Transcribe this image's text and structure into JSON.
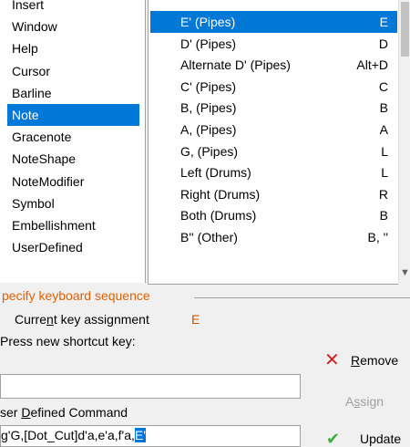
{
  "categories": [
    {
      "label": "Insert",
      "selected": false
    },
    {
      "label": "Window",
      "selected": false
    },
    {
      "label": "Help",
      "selected": false
    },
    {
      "label": "Cursor",
      "selected": false
    },
    {
      "label": "Barline",
      "selected": false
    },
    {
      "label": "Note",
      "selected": true
    },
    {
      "label": "Gracenote",
      "selected": false
    },
    {
      "label": "NoteShape",
      "selected": false
    },
    {
      "label": "NoteModifier",
      "selected": false
    },
    {
      "label": "Symbol",
      "selected": false
    },
    {
      "label": "Embellishment",
      "selected": false
    },
    {
      "label": "UserDefined",
      "selected": false
    }
  ],
  "commands": [
    {
      "name": "E' (Pipes)",
      "key": "E",
      "selected": true
    },
    {
      "name": "D' (Pipes)",
      "key": "D",
      "selected": false
    },
    {
      "name": "Alternate D' (Pipes)",
      "key": "Alt+D",
      "selected": false
    },
    {
      "name": "C' (Pipes)",
      "key": "C",
      "selected": false
    },
    {
      "name": "B, (Pipes)",
      "key": "B",
      "selected": false
    },
    {
      "name": "A, (Pipes)",
      "key": "A",
      "selected": false
    },
    {
      "name": "G, (Pipes)",
      "key": "L",
      "selected": false
    },
    {
      "name": "Left (Drums)",
      "key": "L",
      "selected": false
    },
    {
      "name": "Right (Drums)",
      "key": "R",
      "selected": false
    },
    {
      "name": "Both (Drums)",
      "key": "B",
      "selected": false
    },
    {
      "name": "B'' (Other)",
      "key": "B, ''",
      "selected": false
    }
  ],
  "keyboard": {
    "section_label": "pecify keyboard sequence",
    "current_label_pre": "Curre",
    "current_label_ul": "n",
    "current_label_post": "t key assignment",
    "current_value": "E",
    "press_label": "Press new shortcut key:",
    "shortcut_value": "",
    "cmd_label_pre": "ser ",
    "cmd_label_ul": "D",
    "cmd_label_post": "efined Command",
    "cmd_value_pre": "g'G,[Dot_Cut]d'a,e'a,f'a,",
    "cmd_value_hl": "E'"
  },
  "buttons": {
    "remove_ul": "R",
    "remove_rest": "emove",
    "assign_pre": "A",
    "assign_ul": "s",
    "assign_post": "sign",
    "update": "Update"
  },
  "icons": {
    "remove": "x-icon",
    "update": "checkmark-icon",
    "scroll": "scroll-down-icon"
  },
  "colors": {
    "selection": "#0078d7",
    "section_label": "#e06000",
    "current_value": "#c05800",
    "remove_icon": "#d02020",
    "update_icon": "#3cb040",
    "disabled_text": "#a0a0a0"
  }
}
